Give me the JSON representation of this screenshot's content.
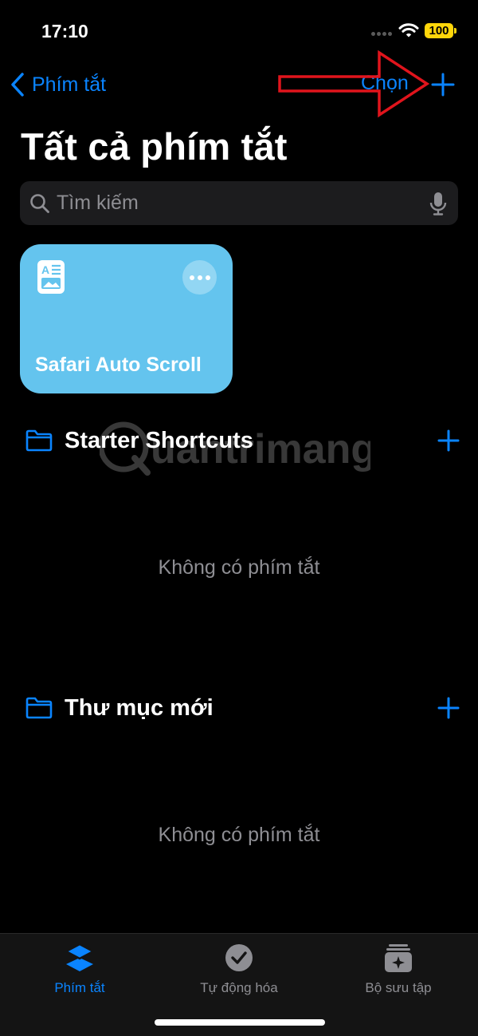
{
  "status_bar": {
    "time": "17:10",
    "battery": "100"
  },
  "nav": {
    "back_label": "Phím tắt",
    "select_label": "Chọn"
  },
  "page_title": "Tất cả phím tắt",
  "search": {
    "placeholder": "Tìm kiếm"
  },
  "shortcut_card": {
    "title": "Safari Auto Scroll",
    "color": "#64c4ee"
  },
  "folders": [
    {
      "title": "Starter Shortcuts",
      "empty_text": "Không có phím tắt"
    },
    {
      "title": "Thư mục mới",
      "empty_text": "Không có phím tắt"
    }
  ],
  "watermark": "uantrimang",
  "tab_bar": {
    "tabs": [
      {
        "label": "Phím tắt",
        "icon": "layers-icon",
        "active": true
      },
      {
        "label": "Tự động hóa",
        "icon": "clock-check-icon",
        "active": false
      },
      {
        "label": "Bộ sưu tập",
        "icon": "gallery-icon",
        "active": false
      }
    ]
  },
  "colors": {
    "accent": "#0a84ff",
    "annotation_arrow": "#e0141c",
    "battery": "#ffd60a"
  }
}
